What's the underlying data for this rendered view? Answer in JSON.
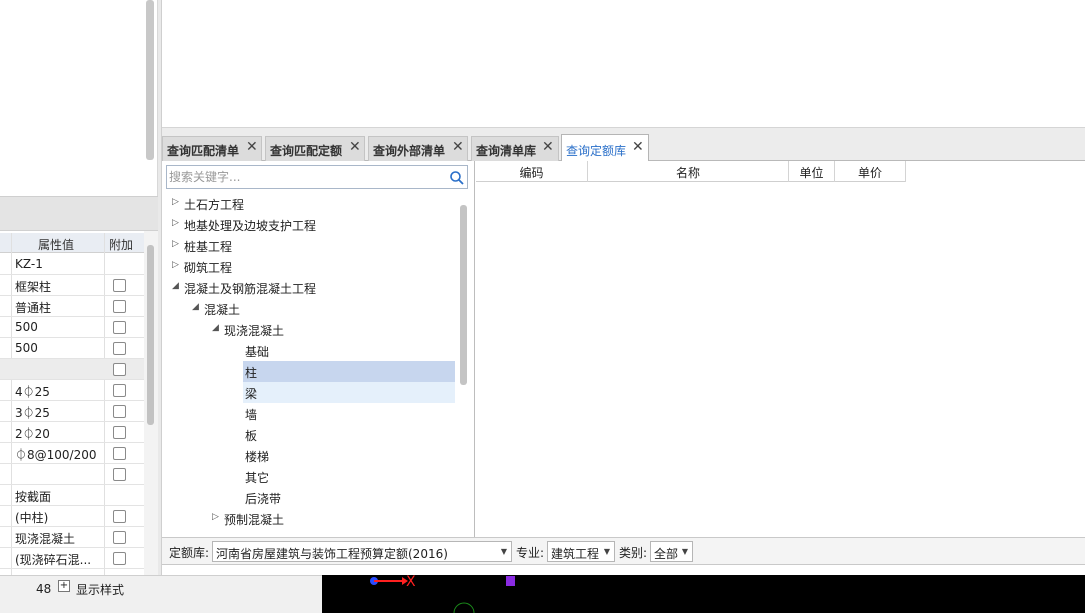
{
  "left_panel": {
    "property_table": {
      "header_value": "属性值",
      "header_attach": "附加",
      "rows": [
        {
          "value": "KZ-1",
          "checkbox": false
        },
        {
          "value": "框架柱",
          "checkbox": true
        },
        {
          "value": "普通柱",
          "checkbox": true
        },
        {
          "value": "500",
          "checkbox": true
        },
        {
          "value": "500",
          "checkbox": true
        },
        {
          "value": "",
          "checkbox": true
        },
        {
          "value": "4⏀25",
          "checkbox": true
        },
        {
          "value": "3⏀25",
          "checkbox": true
        },
        {
          "value": "2⏀20",
          "checkbox": true
        },
        {
          "value": "⏀8@100/200",
          "checkbox": true
        },
        {
          "value": "",
          "checkbox": true
        },
        {
          "value": "按截面",
          "checkbox": false
        },
        {
          "value": "(中柱)",
          "checkbox": true
        },
        {
          "value": "现浇混凝土",
          "checkbox": true
        },
        {
          "value": "(现浇碎石混...",
          "checkbox": true
        }
      ]
    },
    "status": {
      "row_number": "48",
      "expand_symbol": "+",
      "style_label": "显示样式"
    }
  },
  "tabs": [
    {
      "label": "查询匹配清单",
      "active": false
    },
    {
      "label": "查询匹配定额",
      "active": false
    },
    {
      "label": "查询外部清单",
      "active": false
    },
    {
      "label": "查询清单库",
      "active": false
    },
    {
      "label": "查询定额库",
      "active": true
    }
  ],
  "search": {
    "placeholder": "搜索关键字...",
    "value": ""
  },
  "tree": {
    "nodes": [
      {
        "label": "土石方工程",
        "expanded": false
      },
      {
        "label": "地基处理及边坡支护工程",
        "expanded": false
      },
      {
        "label": "桩基工程",
        "expanded": false
      },
      {
        "label": "砌筑工程",
        "expanded": false
      },
      {
        "label": "混凝土及钢筋混凝土工程",
        "expanded": true
      },
      {
        "label": "混凝土",
        "expanded": true
      },
      {
        "label": "现浇混凝土",
        "expanded": true
      },
      {
        "label": "预制混凝土",
        "expanded": false
      }
    ],
    "leaves": [
      "基础",
      "柱",
      "梁",
      "墙",
      "板",
      "楼梯",
      "其它",
      "后浇带"
    ],
    "selected_leaf": "柱",
    "hovered_leaf": "梁"
  },
  "result_table": {
    "columns": [
      "编码",
      "名称",
      "单位",
      "单价"
    ],
    "rows": []
  },
  "filter_bar": {
    "quota_label": "定额库:",
    "quota_value": "河南省房屋建筑与装饰工程预算定额(2016)",
    "major_label": "专业:",
    "major_value": "建筑工程",
    "category_label": "类别:",
    "category_value": "全部"
  },
  "canvas": {
    "axis_label": "X"
  },
  "colors": {
    "active_tab_text": "#2a6fc9",
    "selected_row": "#c7d6ee",
    "hover_row": "#e5f0fb"
  }
}
